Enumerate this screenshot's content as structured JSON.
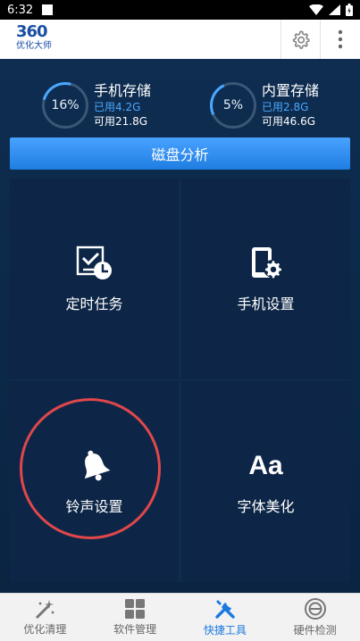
{
  "status_bar": {
    "time": "6:32"
  },
  "app": {
    "logo_number": "360",
    "logo_text": "优化大师"
  },
  "storage": {
    "phone": {
      "title": "手机存储",
      "percent": "16%",
      "used": "已用4.2G",
      "available": "可用21.8G"
    },
    "internal": {
      "title": "内置存储",
      "percent": "5%",
      "used": "已用2.8G",
      "available": "可用46.6G"
    }
  },
  "disk_button": "磁盘分析",
  "tools": [
    {
      "label": "定时任务",
      "icon": "scheduled-task-icon"
    },
    {
      "label": "手机设置",
      "icon": "phone-settings-icon"
    },
    {
      "label": "铃声设置",
      "icon": "bell-icon"
    },
    {
      "label": "字体美化",
      "icon": "font-icon"
    }
  ],
  "font_icon_text": "Aa",
  "bottom_nav": [
    {
      "label": "优化清理",
      "icon": "magic-wand-icon",
      "active": false
    },
    {
      "label": "软件管理",
      "icon": "apps-grid-icon",
      "active": false
    },
    {
      "label": "快捷工具",
      "icon": "tools-icon",
      "active": true
    },
    {
      "label": "硬件检测",
      "icon": "hardware-icon",
      "active": false
    }
  ],
  "colors": {
    "accent_blue": "#1b7ae0",
    "highlight_red": "#e0474a",
    "background": "#0d2a4b"
  }
}
